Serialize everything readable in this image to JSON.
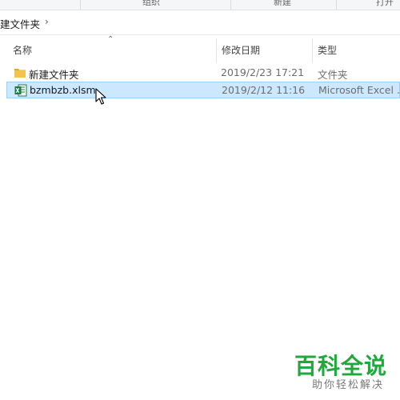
{
  "ribbon": {
    "groups": [
      "组织",
      "新建",
      "打开"
    ]
  },
  "breadcrumb": {
    "current": "建文件夹"
  },
  "columns": {
    "name": "名称",
    "date": "修改日期",
    "type": "类型"
  },
  "rows": [
    {
      "name": "新建文件夹",
      "date": "2019/2/23 17:21",
      "type": "文件夹",
      "icon": "folder-icon",
      "selected": false
    },
    {
      "name": "bzmbzb.xlsm",
      "date": "2019/2/12 11:16",
      "type": "Microsoft Excel ...",
      "icon": "excel-file-icon",
      "selected": true
    }
  ],
  "watermark": {
    "title": "百科全说",
    "subtitle": "助你轻松解决"
  },
  "colors": {
    "selection_bg": "#cce8ff",
    "selection_border": "#99d1ff",
    "watermark_green": "#1fa83c",
    "folder_yellow": "#f3c44d",
    "excel_green": "#1d7a43"
  }
}
